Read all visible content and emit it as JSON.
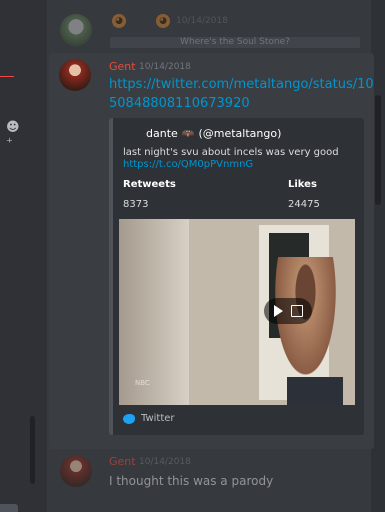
{
  "top_message": {
    "username": "",
    "timestamp": "10/14/2018",
    "reply_text": "Where's the Soul Stone?"
  },
  "main_message": {
    "username": "Gent",
    "timestamp": "10/14/2018",
    "link": "https://twitter.com/metaltango/status/1050848808110673920",
    "embed": {
      "author": "dante 🦇 (@metaltango)",
      "description": "last night's svu about incels was very good",
      "short_link": "https://t.co/QM0pPVnmnG",
      "fields": [
        {
          "name": "Retweets",
          "value": "8373"
        },
        {
          "name": "Likes",
          "value": "24475"
        }
      ],
      "video_watermark": "NBC",
      "footer": "Twitter"
    }
  },
  "bottom_message": {
    "username": "Gent",
    "timestamp": "10/14/2018",
    "text": "I thought this was a parody"
  },
  "colors": {
    "background": "#36393e",
    "link": "#0096cf",
    "username_gent": "#e74c3c",
    "embed_border": "#4f545c"
  }
}
